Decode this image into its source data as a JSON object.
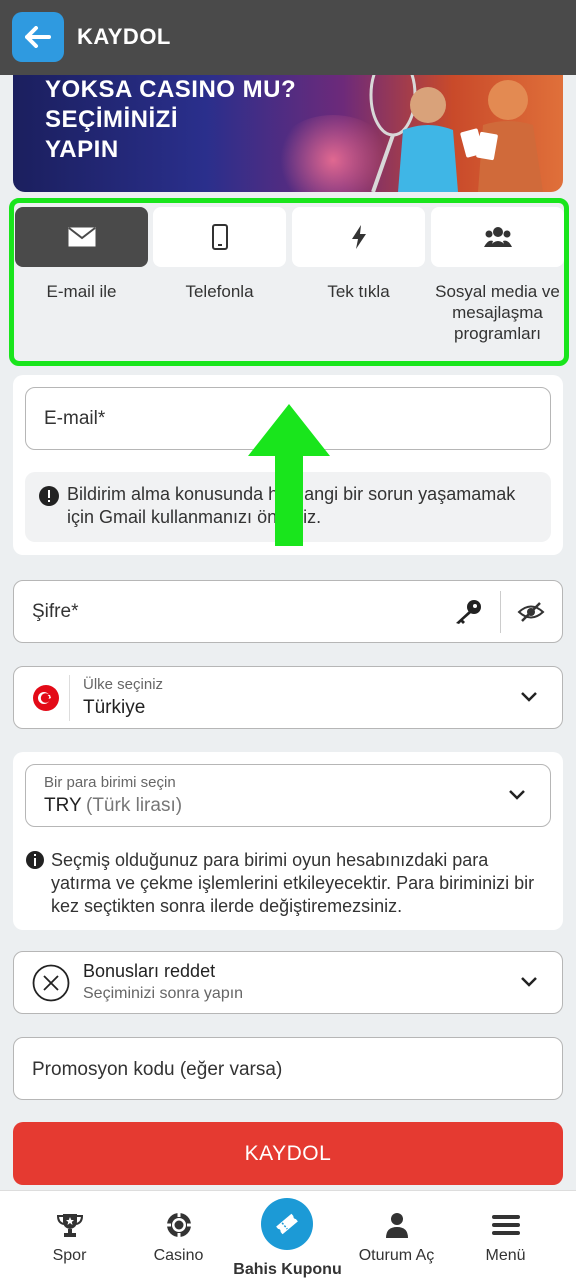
{
  "header": {
    "title": "KAYDOL"
  },
  "banner": {
    "line1": "YOKSA CASINO MU?",
    "line2": "SEÇİMİNİZİ",
    "line3": "YAPIN"
  },
  "methods": [
    {
      "label": "E-mail ile",
      "icon": "envelope-icon",
      "active": true
    },
    {
      "label": "Telefonla",
      "icon": "phone-icon",
      "active": false
    },
    {
      "label": "Tek tıkla",
      "icon": "lightning-icon",
      "active": false
    },
    {
      "label": "Sosyal media ve mesajlaşma programları",
      "icon": "users-icon",
      "active": false
    }
  ],
  "email": {
    "placeholder": "E-mail*",
    "note": "Bildirim alma konusunda herhangi bir sorun yaşamamak için Gmail kullanmanızı öneririz."
  },
  "password": {
    "placeholder": "Şifre*"
  },
  "country": {
    "label": "Ülke seçiniz",
    "value": "Türkiye"
  },
  "currency": {
    "label": "Bir para birimi seçin",
    "code": "TRY",
    "name": "(Türk lirası)",
    "note": "Seçmiş olduğunuz para birimi oyun hesabınızdaki para yatırma ve çekme işlemlerini etkileyecektir. Para biriminizi bir kez seçtikten sonra ilerde değiştiremezsiniz."
  },
  "bonus": {
    "title": "Bonusları reddet",
    "subtitle": "Seçiminizi sonra yapın"
  },
  "promo": {
    "placeholder": "Promosyon kodu (eğer varsa)"
  },
  "submit_label": "KAYDOL",
  "nav": [
    {
      "label": "Spor",
      "icon": "trophy-icon"
    },
    {
      "label": "Casino",
      "icon": "casino-chip-icon"
    },
    {
      "label": "Bahis Kuponu",
      "icon": "ticket-icon"
    },
    {
      "label": "Oturum Aç",
      "icon": "user-icon"
    },
    {
      "label": "Menü",
      "icon": "menu-icon"
    }
  ],
  "colors": {
    "accent": "#2f9ae0",
    "highlight": "#19e51c",
    "submit": "#e53a31",
    "header": "#4a4a4a"
  }
}
